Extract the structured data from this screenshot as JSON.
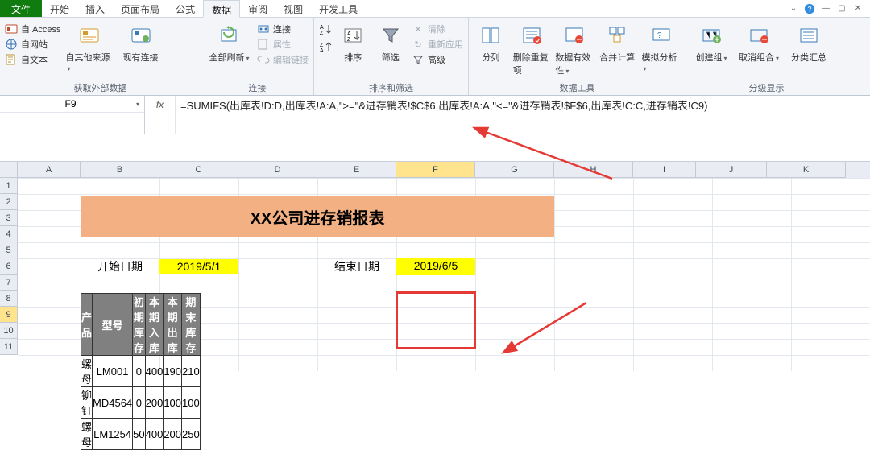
{
  "tabs": {
    "file": "文件",
    "home": "开始",
    "insert": "插入",
    "layout": "页面布局",
    "formulas": "公式",
    "data": "数据",
    "review": "审阅",
    "view": "视图",
    "dev": "开发工具"
  },
  "ribbon": {
    "ext_data": {
      "access": "自 Access",
      "web": "自网站",
      "text": "自文本",
      "other": "自其他来源",
      "existing": "现有连接",
      "label": "获取外部数据"
    },
    "conn": {
      "refresh": "全部刷新",
      "connect": "连接",
      "props": "属性",
      "editlinks": "编辑链接",
      "label": "连接"
    },
    "sortfilter": {
      "sort": "排序",
      "filter": "筛选",
      "clear": "清除",
      "reapply": "重新应用",
      "advanced": "高级",
      "label": "排序和筛选"
    },
    "datatools": {
      "t2c": "分列",
      "rmdup": "删除重复项",
      "valid": "数据有效性",
      "consol": "合并计算",
      "whatif": "模拟分析",
      "label": "数据工具"
    },
    "outline": {
      "group": "创建组",
      "ungroup": "取消组合",
      "subtotal": "分类汇总",
      "label": "分级显示"
    }
  },
  "namebox": "F9",
  "fx_label": "fx",
  "formula": "=SUMIFS(出库表!D:D,出库表!A:A,\">=\"&进存销表!$C$6,出库表!A:A,\"<=\"&进存销表!$F$6,出库表!C:C,进存销表!C9)",
  "columns": [
    "A",
    "B",
    "C",
    "D",
    "E",
    "F",
    "G",
    "H",
    "I",
    "J",
    "K"
  ],
  "rows": [
    "1",
    "2",
    "3",
    "4",
    "5",
    "6",
    "7",
    "8",
    "9",
    "10",
    "11"
  ],
  "sheet": {
    "title": "XX公司进存销报表",
    "start_label": "开始日期",
    "start_value": "2019/5/1",
    "end_label": "结束日期",
    "end_value": "2019/6/5",
    "headers": [
      "产品",
      "型号",
      "初期库存",
      "本期入库",
      "本期出库",
      "期末库存"
    ],
    "data": [
      [
        "螺母",
        "LM001",
        "0",
        "400",
        "190",
        "210"
      ],
      [
        "铆钉",
        "MD4564",
        "0",
        "200",
        "100",
        "100"
      ],
      [
        "螺母",
        "LM1254",
        "50",
        "400",
        "200",
        "250"
      ]
    ]
  }
}
